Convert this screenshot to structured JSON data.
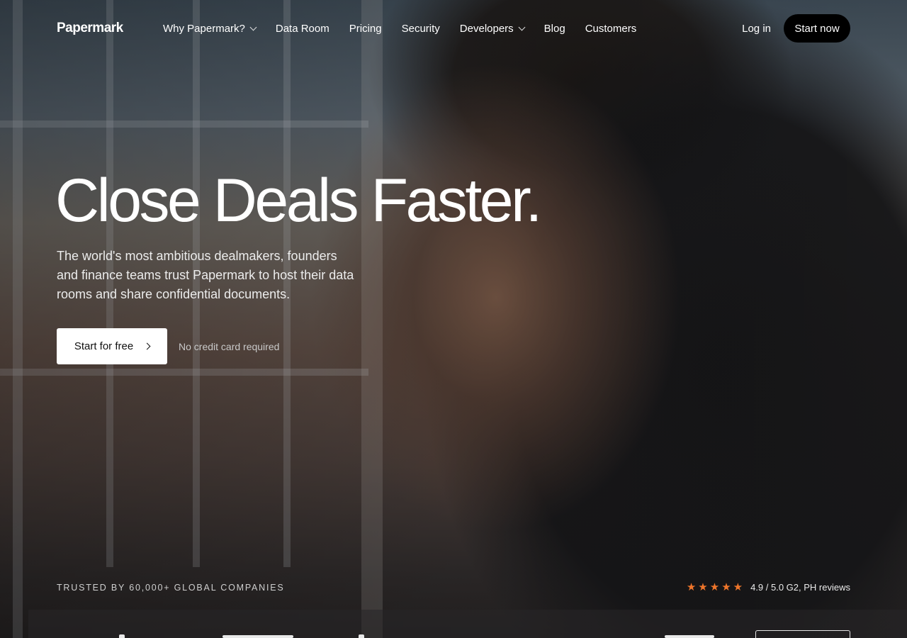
{
  "nav": {
    "logo": "Papermark",
    "links": [
      {
        "label": "Why Papermark?",
        "dropdown": true
      },
      {
        "label": "Data Room",
        "dropdown": false
      },
      {
        "label": "Pricing",
        "dropdown": false
      },
      {
        "label": "Security",
        "dropdown": false
      },
      {
        "label": "Developers",
        "dropdown": true
      },
      {
        "label": "Blog",
        "dropdown": false
      },
      {
        "label": "Customers",
        "dropdown": false
      }
    ],
    "login": "Log in",
    "start_now": "Start now"
  },
  "hero": {
    "title": "Close Deals Faster.",
    "subtitle": "The world's most ambitious dealmakers, founders and finance teams trust Papermark to host their data rooms and share confidential documents.",
    "cta_label": "Start for free",
    "cta_note": "No credit card required"
  },
  "trust": {
    "trusted_text": "TRUSTED BY 60,000+ GLOBAL COMPANIES",
    "stars": 5,
    "rating_text": "4.9 / 5.0 G2, PH reviews",
    "star_color": "#f0762b"
  },
  "colors": {
    "primary_button_bg": "#000000",
    "cta_bg": "#ffffff"
  }
}
